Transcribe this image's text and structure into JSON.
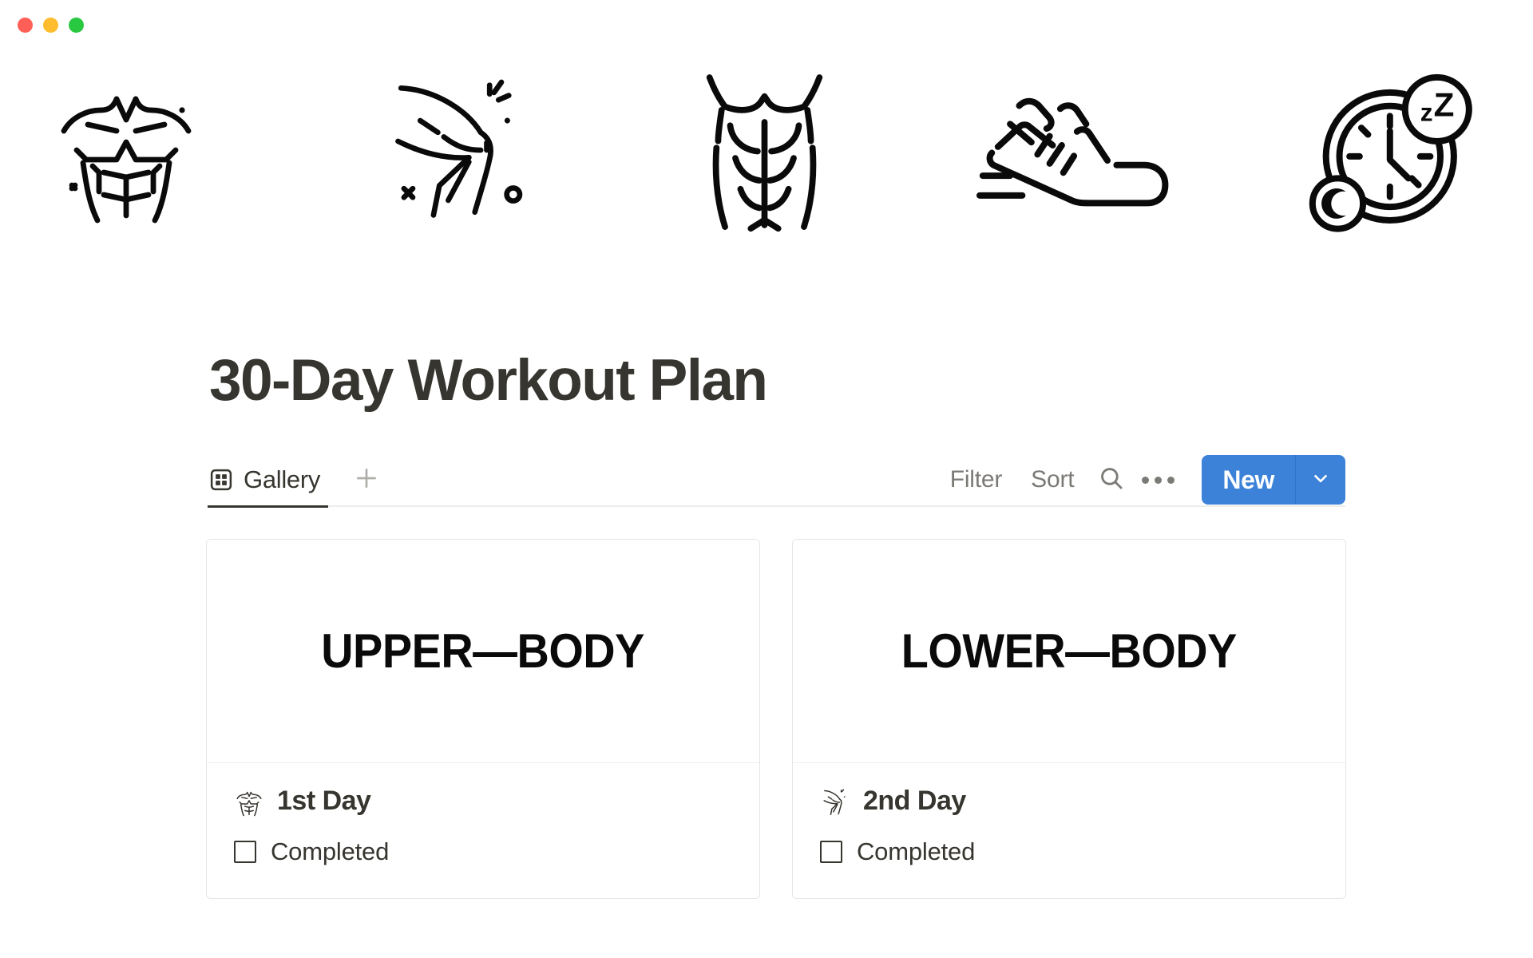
{
  "window": {
    "traffic_lights": [
      {
        "name": "close",
        "color": "#FF5F57"
      },
      {
        "name": "minimize",
        "color": "#FEBC2E"
      },
      {
        "name": "zoom",
        "color": "#28C840"
      }
    ]
  },
  "cover": {
    "icons": [
      {
        "name": "chest-muscle-icon",
        "label": "Chest / pecs muscle"
      },
      {
        "name": "flexing-arm-icon",
        "label": "Flexing arm muscle"
      },
      {
        "name": "abs-six-pack-icon",
        "label": "Abs six pack"
      },
      {
        "name": "running-sneaker-icon",
        "label": "Running sneaker"
      },
      {
        "name": "sleep-clock-icon",
        "label": "Sleep clock zZ"
      }
    ]
  },
  "page": {
    "title": "30-Day Workout Plan"
  },
  "toolbar": {
    "view_tab_label": "Gallery",
    "view_tab_icon": "grid-icon",
    "add_view_icon": "plus-icon",
    "filter_label": "Filter",
    "sort_label": "Sort",
    "search_icon": "search-icon",
    "more_icon": "ellipsis-icon",
    "new_label": "New",
    "new_caret_icon": "chevron-down-icon",
    "accent_color": "#3B82D8"
  },
  "gallery": {
    "cards": [
      {
        "media_text": "UPPER—BODY",
        "emoji": "chest-muscle-icon",
        "title": "1st Day",
        "checkbox_label": "Completed",
        "checked": false
      },
      {
        "media_text": "LOWER—BODY",
        "emoji": "flexing-arm-icon",
        "title": "2nd Day",
        "checkbox_label": "Completed",
        "checked": false
      }
    ]
  }
}
